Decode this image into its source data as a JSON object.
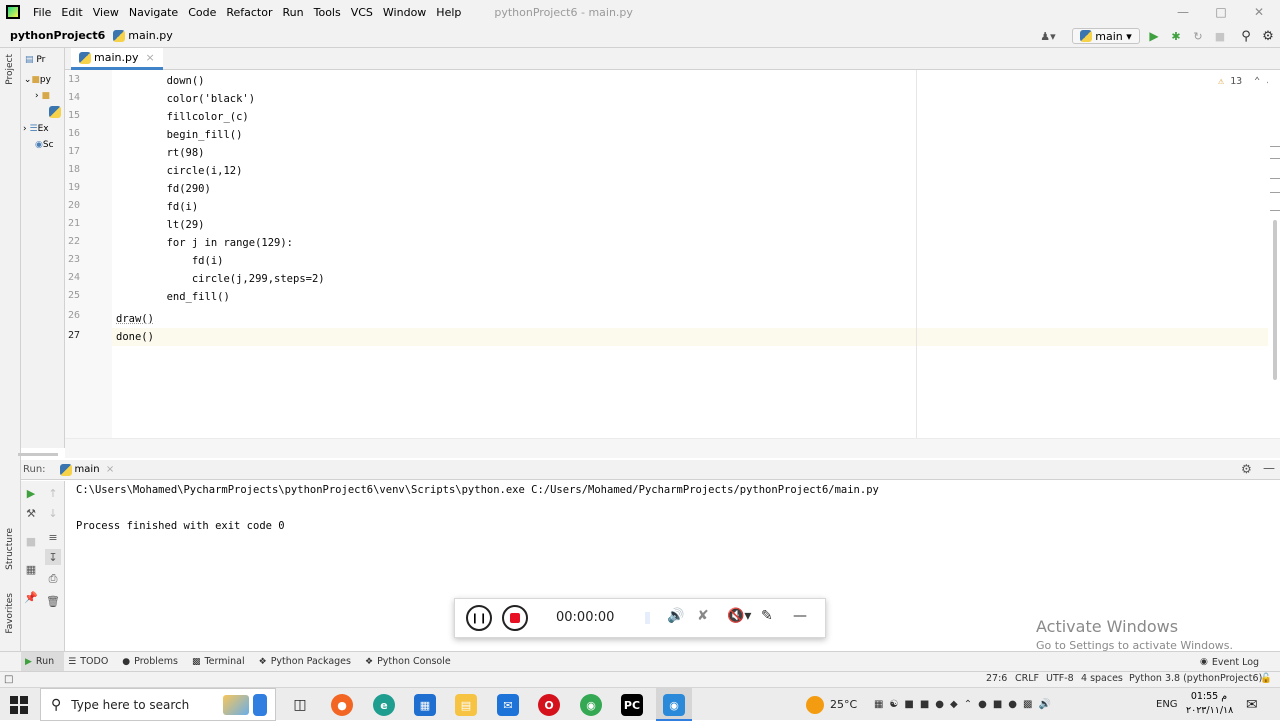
{
  "menubar": {
    "items": [
      "File",
      "Edit",
      "View",
      "Navigate",
      "Code",
      "Refactor",
      "Run",
      "Tools",
      "VCS",
      "Window",
      "Help"
    ],
    "window_title": "pythonProject6 - main.py"
  },
  "navbar": {
    "project": "pythonProject6",
    "file": "main.py",
    "run_config": "main"
  },
  "left_strip": {
    "project_label": "Project",
    "structure_label": "Structure",
    "favorites_label": "Favorites"
  },
  "project_panel": {
    "title": "Pr",
    "rows": [
      "py",
      "",
      "",
      "Ex",
      "Sc"
    ]
  },
  "editor": {
    "tab": "main.py",
    "warnings": "13",
    "line_numbers": [
      "13",
      "14",
      "15",
      "16",
      "17",
      "18",
      "19",
      "20",
      "21",
      "22",
      "23",
      "24",
      "25",
      "26",
      "27"
    ],
    "lines": [
      "        down()",
      "        color('black')",
      "        fillcolor_(c)",
      "        begin_fill()",
      "        rt(98)",
      "        circle(i,12)",
      "        fd(290)",
      "        fd(i)",
      "        lt(29)",
      "        for j in range(129):",
      "            fd(i)",
      "            circle(j,299,steps=2)",
      "        end_fill()",
      "draw()",
      "done()"
    ]
  },
  "run_panel": {
    "label": "Run:",
    "tab": "main",
    "console": [
      "C:\\Users\\Mohamed\\PycharmProjects\\pythonProject6\\venv\\Scripts\\python.exe C:/Users/Mohamed/PycharmProjects/pythonProject6/main.py",
      "",
      "Process finished with exit code 0"
    ]
  },
  "recorder": {
    "time": "00:00:00"
  },
  "watermark": {
    "title": "Activate Windows",
    "subtitle": "Go to Settings to activate Windows."
  },
  "bottom_tabs": {
    "run": "Run",
    "todo": "TODO",
    "problems": "Problems",
    "terminal": "Terminal",
    "packages": "Python Packages",
    "console": "Python Console",
    "event_log": "Event Log"
  },
  "statusbar": {
    "position": "27:6",
    "line_sep": "CRLF",
    "encoding": "UTF-8",
    "indent": "4 spaces",
    "interpreter": "Python 3.8 (pythonProject6)"
  },
  "taskbar": {
    "search_placeholder": "Type here to search",
    "temperature": "25°C",
    "lang": "ENG",
    "time": "01:55 م",
    "date": "٢٠٢٣/١١/١٨"
  }
}
